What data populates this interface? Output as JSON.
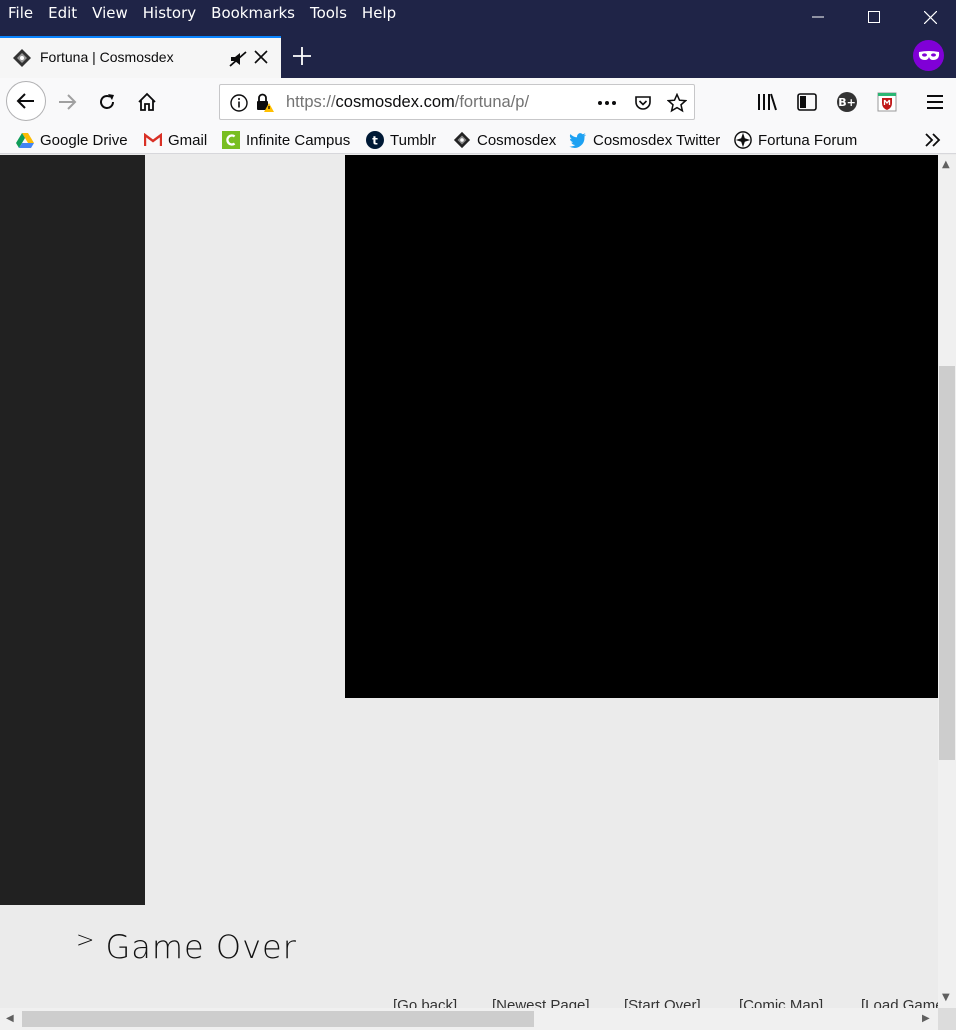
{
  "menu": [
    "File",
    "Edit",
    "View",
    "History",
    "Bookmarks",
    "Tools",
    "Help"
  ],
  "tab": {
    "title": "Fortuna | Cosmosdex"
  },
  "url": {
    "scheme": "https://",
    "host": "cosmosdex.com",
    "path": "/fortuna/p/"
  },
  "bookmarks": [
    {
      "label": "Google Drive",
      "icon": "google-drive-icon"
    },
    {
      "label": "Gmail",
      "icon": "gmail-icon"
    },
    {
      "label": "Infinite Campus",
      "icon": "infinite-campus-icon"
    },
    {
      "label": "Tumblr",
      "icon": "tumblr-icon"
    },
    {
      "label": "Cosmosdex",
      "icon": "cosmosdex-icon"
    },
    {
      "label": "Cosmosdex Twitter",
      "icon": "twitter-icon"
    },
    {
      "label": "Fortuna Forum",
      "icon": "fortuna-forum-icon"
    }
  ],
  "page": {
    "prompt": ">",
    "heading": "Game Over",
    "links": [
      "[Go back]",
      "[Newest Page]",
      "[Start Over]",
      "[Comic Map]",
      "[Load Game]"
    ]
  },
  "colors": {
    "titlebar": "#1f2447",
    "tab_accent": "#0a84ff",
    "private_badge": "#8000d7",
    "page_bg": "#ebebeb",
    "sidebar": "#212121"
  }
}
